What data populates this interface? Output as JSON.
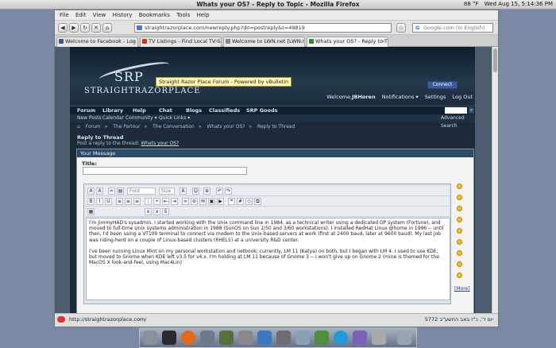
{
  "panel": {
    "title": "Whats your OS? - Reply to Topic - Mozilla Firefox",
    "temp": "88 °F",
    "datetime": "Wed Aug 15,  5:14:36 PM"
  },
  "menu": [
    "File",
    "Edit",
    "View",
    "History",
    "Bookmarks",
    "Tools",
    "Help"
  ],
  "url": "straightrazorplace.com/newreply.php?do=postreply&t=49819",
  "search_placeholder": "Google.com (in English)",
  "tabs": [
    {
      "label": "Welcome to Facebook - Log ...",
      "color": "#3b5998"
    },
    {
      "label": "TV Listings - Find Local TV S...",
      "color": "#c0392b"
    },
    {
      "label": "Welcome to LWN.net [LWN.n...",
      "color": "#888888"
    },
    {
      "label": "Whats your OS? - Reply to T...",
      "color": "#2a8a3a"
    }
  ],
  "site": {
    "logo": "SRP",
    "logo_name": "STRAIGHTRAZORPLACE",
    "tooltip": "Straight Razor Place Forum - Powered by vBulletin",
    "connect": "Connect",
    "welcome": [
      "Welcome,",
      "JBHoren",
      "Notifications ▾",
      "Settings",
      "Log Out"
    ],
    "nav": [
      "Forum",
      "Library",
      "Help",
      "Chat",
      "Blogs",
      "Classifieds",
      "SRP Goods"
    ],
    "subnav": [
      "New Posts",
      "Calendar",
      "Community ▾",
      "Quick Links ▾"
    ],
    "advanced_search": "Advanced Search",
    "crumbs": [
      "Forum",
      "The Parlour",
      "The Conversation",
      "Whats your OS?",
      "Reply to Thread"
    ],
    "reply_title": "Reply to Thread",
    "reply_sub_prefix": "Post a reply to the thread:",
    "reply_sub_link": "Whats your OS?",
    "message_header": "Your Message",
    "title_label": "Title:",
    "font_select": "Font",
    "size_select": "Size",
    "more": "[More]",
    "post_p1": "I'm JimmyHAD's sysadmin. I started working with the Unix command line in 1984, as a technical writer using a dedicated DP system (Fortune), and moved to full-time Unix systems administration in 1988 (SunOS on Sun 2/50 and 3/60 workstations). I installed RedHat Linux @home in 1996 -- until then, I'd been using a VT100 terminal to connect via modem to the Unix-based servers at work (first at 2400 baud, later at 9600 baud). My last job was riding-herd on a couple of Linux-based clusters (RHEL5) at a university R&D center.",
    "post_p2": "I've been running Linux Mint on my personal workstation and netbook; currently, LM 11 (Katya) on both, but I began with LM 4. I used to use KDE, but moved to Gnome when KDE left v3.5 for v4.x. I'm holding at LM 11 because of Gnome 3 -- I won't give up on Gnome 2 (mine is themed for the MacOS X look-and-feel, using Mac4Lin)"
  },
  "status": {
    "left": "http://straightrazorplace.com/",
    "right": "יום ד', כ\"ז באב התשע\"ב 5772"
  }
}
